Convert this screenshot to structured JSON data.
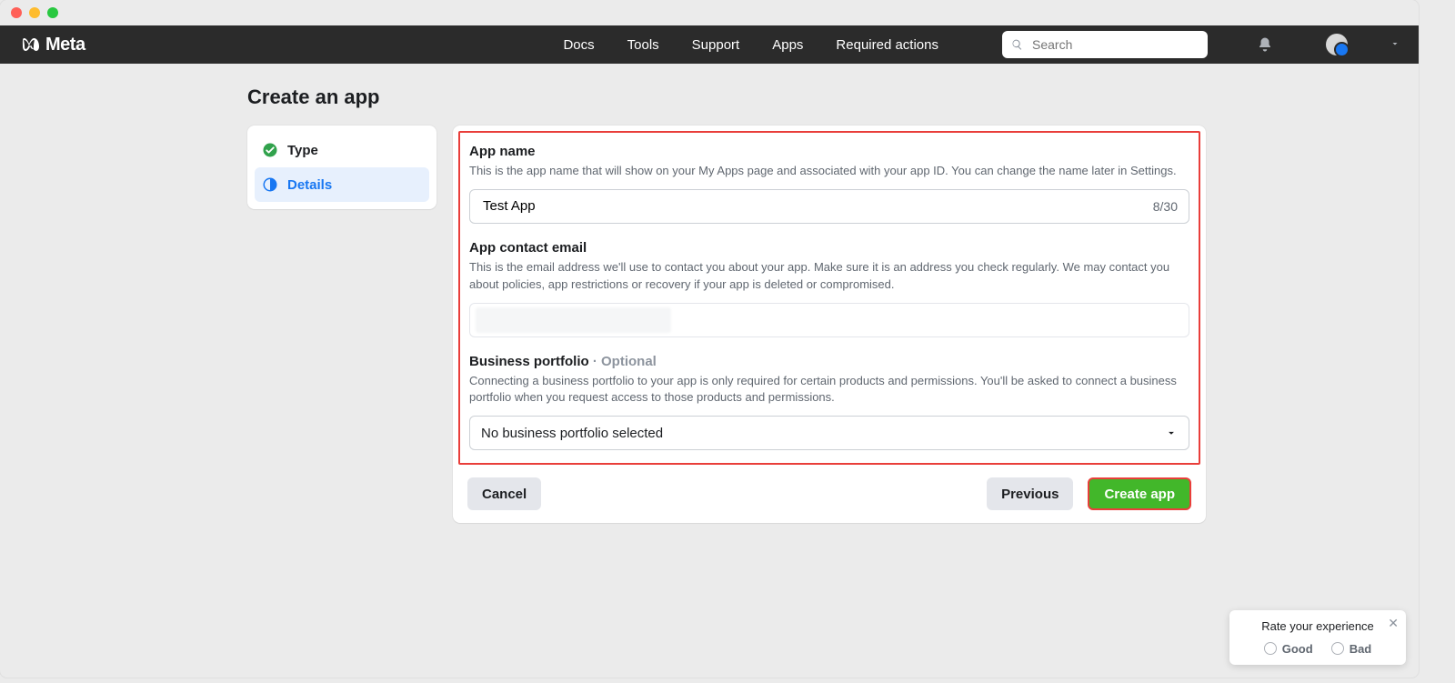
{
  "traffic_lights": [
    "close",
    "minimize",
    "zoom"
  ],
  "brand": {
    "name": "Meta"
  },
  "nav": {
    "items": [
      "Docs",
      "Tools",
      "Support",
      "Apps",
      "Required actions"
    ]
  },
  "search": {
    "placeholder": "Search"
  },
  "page_title": "Create an app",
  "sidebar": {
    "items": [
      {
        "label": "Type",
        "icon": "check-circle",
        "done": true
      },
      {
        "label": "Details",
        "icon": "half-circle",
        "active": true
      }
    ]
  },
  "form": {
    "app_name": {
      "label": "App name",
      "help": "This is the app name that will show on your My Apps page and associated with your app ID. You can change the name later in Settings.",
      "value": "Test App",
      "counter": "8/30"
    },
    "contact_email": {
      "label": "App contact email",
      "help": "This is the email address we'll use to contact you about your app. Make sure it is an address you check regularly. We may contact you about policies, app restrictions or recovery if your app is deleted or compromised.",
      "value": ""
    },
    "portfolio": {
      "label": "Business portfolio",
      "optional": " · Optional",
      "help": "Connecting a business portfolio to your app is only required for certain products and permissions. You'll be asked to connect a business portfolio when you request access to those products and permissions.",
      "selected": "No business portfolio selected"
    }
  },
  "buttons": {
    "cancel": "Cancel",
    "previous": "Previous",
    "create": "Create app"
  },
  "rating": {
    "title": "Rate your experience",
    "good": "Good",
    "bad": "Bad"
  }
}
